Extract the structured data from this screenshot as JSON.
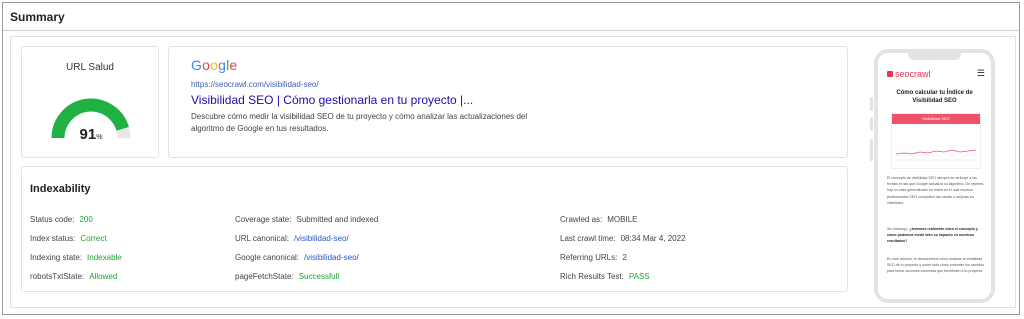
{
  "page": {
    "title": "Summary"
  },
  "health": {
    "title": "URL Salud",
    "score": "91",
    "unit": "%",
    "score_fraction": 0.91,
    "gauge_color": "#1fb141",
    "track_color": "#e8e8e8"
  },
  "serp": {
    "brand": "Google",
    "url": "https://seocrawl.com/visibilidad-seo/",
    "title": "Visibilidad SEO | Cómo gestionarla en tu proyecto |...",
    "description": "Descubre cómo medir la visibilidad SEO de tu proyecto y cómo analizar las actualizaciones del algoritmo de Google en tus resultados."
  },
  "indexability": {
    "title": "Indexability",
    "status_code": {
      "label": "Status code:",
      "value": "200"
    },
    "index_status": {
      "label": "Index status:",
      "value": "Correct"
    },
    "indexing_state": {
      "label": "Indexing state:",
      "value": "Indexable"
    },
    "robots_txt_state": {
      "label": "robotsTxtState:",
      "value": "Allowed"
    },
    "coverage_state": {
      "label": "Coverage state:",
      "value": "Submitted and indexed"
    },
    "url_canonical": {
      "label": "URL canonical:",
      "value": "/visibilidad-seo/"
    },
    "google_canonical": {
      "label": "Google canonical:",
      "value": "/visibilidad-seo/"
    },
    "page_fetch_state": {
      "label": "pageFetchState:",
      "value": "Successfull"
    },
    "crawled_as": {
      "label": "Crawled as:",
      "value": "MOBILE"
    },
    "last_crawl_time": {
      "label": "Last crawl time:",
      "value": "08:34 Mar 4, 2022"
    },
    "referring_urls": {
      "label": "Referring URLs:",
      "value": "2"
    },
    "rich_results_test": {
      "label": "Rich Results Test:",
      "value": "PASS"
    }
  },
  "phone_preview": {
    "logo_text": "seocrawl",
    "heading": "Cómo calcular tu Índice de Visibilidad SEO",
    "chart_title": "Visibilidad SEO",
    "paragraph1": "El concepto de visibilidad SEO siempre se atribuye a las fechas en las que Google actualiza su algoritmo. De repente, hay un caso generalizado en redes en el cual muchos profesionales SEO comparten las caídas o mejoras en visibilidad.",
    "paragraph2_prefix": "Sin embargo, ",
    "paragraph2_bold": "¿tenemos realmente claro el concepto y cómo podemos medir bien su impacto en nuestros resultados?",
    "paragraph3": "En este artículo, te descubrimos cómo analizar la visibilidad SEO de tu proyecto y sobre todo cómo entender los cambios para tomar acciones concretas que beneficien a tu proyecto."
  }
}
